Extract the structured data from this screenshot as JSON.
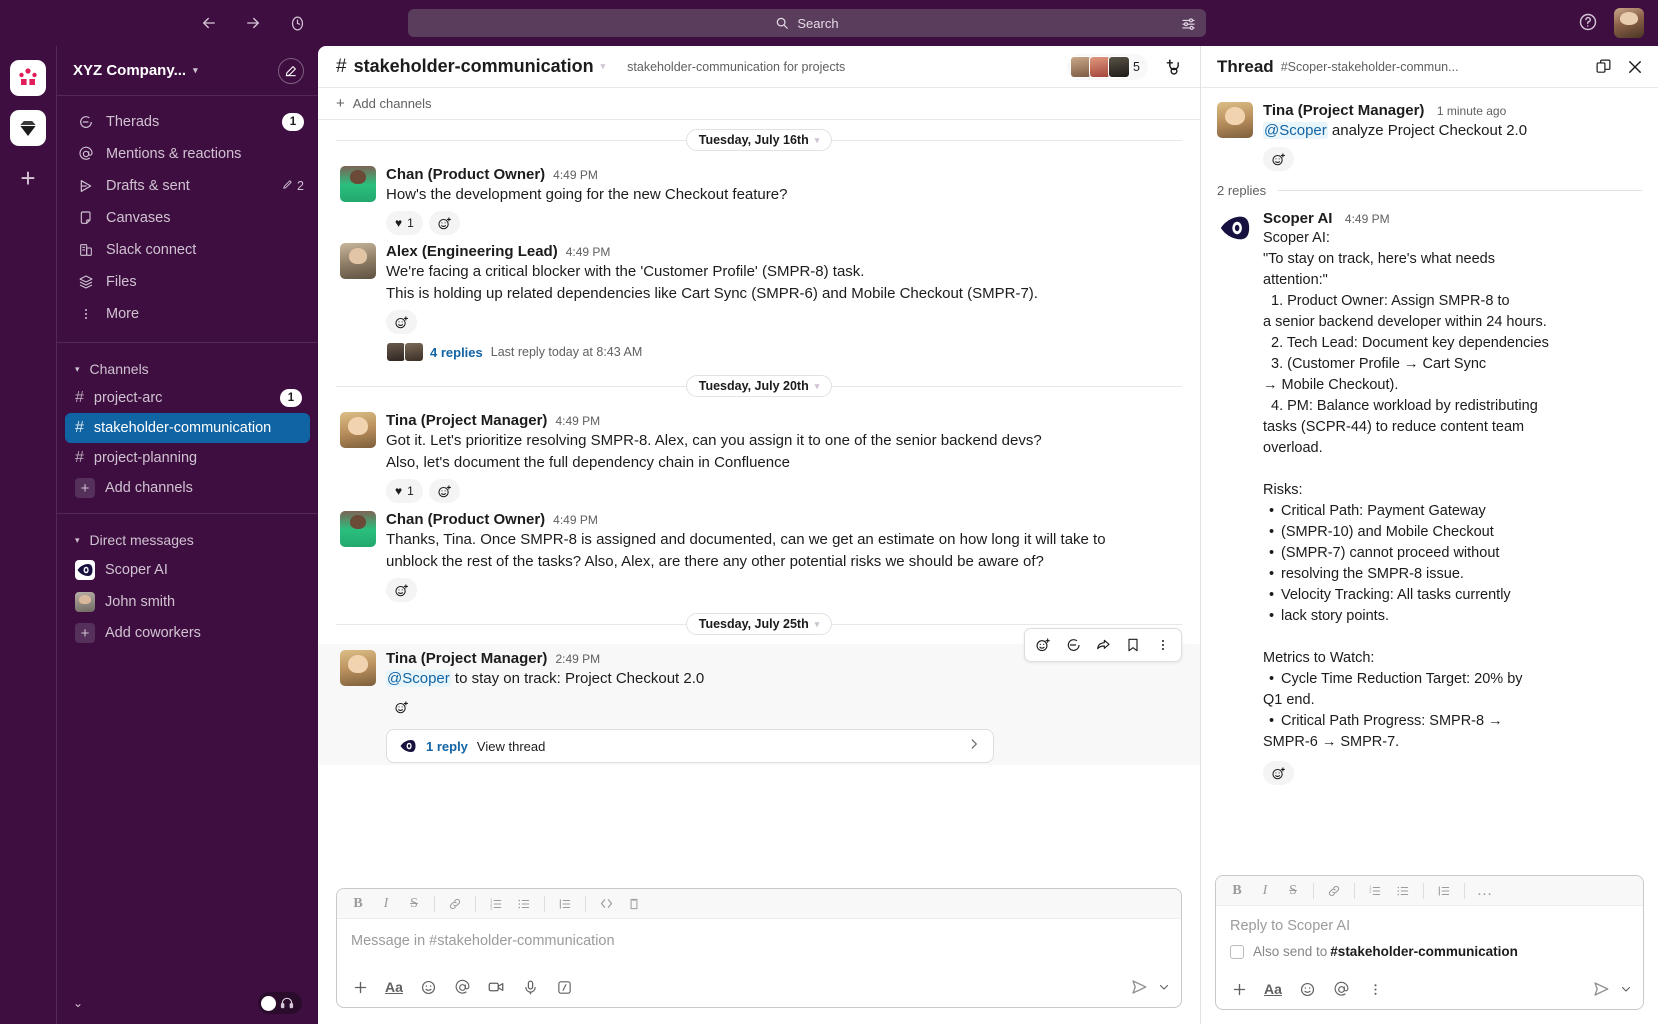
{
  "topbar": {
    "back_icon": "arrow-left-icon",
    "forward_icon": "arrow-right-icon",
    "history_icon": "clock-icon",
    "search_placeholder": "Search",
    "help_icon": "question-circle-icon"
  },
  "sidebar": {
    "workspace_name": "XYZ Company...",
    "compose_icon": "compose-icon",
    "nav": [
      {
        "label": "Therads",
        "icon": "threads-icon",
        "badge": "1"
      },
      {
        "label": "Mentions & reactions",
        "icon": "at-icon",
        "badge": ""
      },
      {
        "label": "Drafts & sent",
        "icon": "send-icon",
        "badge": "2"
      },
      {
        "label": "Canvases",
        "icon": "canvas-icon",
        "badge": ""
      },
      {
        "label": "Slack connect",
        "icon": "slack-connect-icon",
        "badge": ""
      },
      {
        "label": "Files",
        "icon": "files-icon",
        "badge": ""
      },
      {
        "label": "More",
        "icon": "more-vertical-icon",
        "badge": ""
      }
    ],
    "channels_title": "Channels",
    "channels": [
      {
        "name": "project-arc",
        "badge": "1",
        "active": false
      },
      {
        "name": "stakeholder-communication",
        "badge": "",
        "active": true
      },
      {
        "name": "project-planning",
        "badge": "",
        "active": false
      }
    ],
    "add_channels": "Add channels",
    "dm_title": "Direct messages",
    "dms": [
      {
        "name": "Scoper AI"
      },
      {
        "name": "John smith"
      }
    ],
    "add_coworkers": "Add coworkers"
  },
  "channel": {
    "hash": "#",
    "name": "stakeholder-communication",
    "topic": "stakeholder-communication for projects",
    "member_count": "5",
    "add_channels_bar": "Add channels",
    "huddle_icon": "huddle-icon"
  },
  "messages": [
    {
      "type": "divider",
      "label": "Tuesday, July 16th"
    },
    {
      "type": "message",
      "avatar": "av-chan",
      "author": "Chan (Product Owner)",
      "time": "4:49 PM",
      "lines": [
        "How's the development going for the new Checkout feature?"
      ],
      "reaction_emoji": "♥",
      "reaction_count": "1",
      "has_add_reaction": true
    },
    {
      "type": "message",
      "avatar": "av-alex",
      "author": "Alex (Engineering Lead)",
      "time": "4:49 PM",
      "lines": [
        "We're facing a critical blocker with the 'Customer Profile' (SMPR-8) task.",
        "This is holding up related dependencies like Cart Sync (SMPR-6) and Mobile Checkout (SMPR-7)."
      ],
      "reaction_emoji": "",
      "reaction_count": "",
      "has_add_reaction": true,
      "thread": {
        "replies": "4 replies",
        "meta": "Last reply today at 8:43 AM"
      }
    },
    {
      "type": "divider",
      "label": "Tuesday, July 20th"
    },
    {
      "type": "message",
      "avatar": "av-tina",
      "author": "Tina (Project Manager)",
      "time": "4:49 PM",
      "lines": [
        "Got it. Let's prioritize resolving SMPR-8. Alex, can you assign it to one of the senior backend devs?",
        "Also, let's document the full dependency chain in Confluence"
      ],
      "reaction_emoji": "♥",
      "reaction_count": "1",
      "has_add_reaction": true
    },
    {
      "type": "message",
      "avatar": "av-chan",
      "author": "Chan (Product Owner)",
      "time": "4:49 PM",
      "lines": [
        "Thanks, Tina. Once SMPR-8 is assigned and documented, can we get an estimate on how long it will take to",
        "unblock the rest of the tasks? Also, Alex, are there any other potential risks we should be aware of?"
      ],
      "reaction_emoji": "",
      "reaction_count": "",
      "has_add_reaction": true
    },
    {
      "type": "divider",
      "label": "Tuesday, July 25th"
    },
    {
      "type": "message",
      "avatar": "av-tina",
      "author": "Tina (Project Manager)",
      "time": "2:49 PM",
      "mention": "@Scoper",
      "lines": [
        " to stay on track: Project Checkout 2.0"
      ],
      "reaction_emoji": "",
      "reaction_count": "",
      "has_add_reaction": true,
      "hovered": true,
      "view_thread": {
        "replies": "1 reply",
        "label": "View thread"
      }
    }
  ],
  "hover_tools": [
    "emoji-icon",
    "reply-icon",
    "share-icon",
    "bookmark-icon",
    "more-icon"
  ],
  "composer": {
    "placeholder": "Message in #stakeholder-communication",
    "format_buttons": [
      "bold-icon",
      "italic-icon",
      "strikethrough-icon",
      "link-icon",
      "ordered-list-icon",
      "bulleted-list-icon",
      "blockquote-icon",
      "code-icon",
      "code-block-icon"
    ],
    "bottom_buttons": [
      "plus-icon",
      "format-icon",
      "emoji-icon",
      "mention-icon",
      "video-icon",
      "microphone-icon",
      "slash-command-icon"
    ],
    "send_icon": "send-icon",
    "send_caret_icon": "chevron-down-icon"
  },
  "thread": {
    "title": "Thread",
    "subtitle": "#Scoper-stakeholder-commun...",
    "expand_icon": "open-in-new-icon",
    "close_icon": "close-icon",
    "root": {
      "author": "Tina (Project Manager)",
      "time": "1 minute ago",
      "mention": "@Scoper",
      "text": " analyze Project Checkout 2.0"
    },
    "replies_label": "2 replies",
    "reply": {
      "author": "Scoper AI",
      "time": "4:49 PM",
      "lines": [
        {
          "kind": "plain",
          "text": "Scoper AI:"
        },
        {
          "kind": "plain",
          "text": "\"To stay on track, here's what needs"
        },
        {
          "kind": "plain",
          "text": "attention:\""
        },
        {
          "kind": "num",
          "text": "1. Product Owner: Assign SMPR-8 to"
        },
        {
          "kind": "plain",
          "text": "a senior backend developer within 24 hours."
        },
        {
          "kind": "num",
          "text": "2. Tech Lead: Document key dependencies"
        },
        {
          "kind": "num",
          "text": "3. (Customer Profile → Cart Sync"
        },
        {
          "kind": "plain",
          "text": "→ Mobile Checkout)."
        },
        {
          "kind": "num",
          "text": "4. PM: Balance workload by redistributing"
        },
        {
          "kind": "plain",
          "text": "tasks (SCPR-44) to reduce content team"
        },
        {
          "kind": "plain",
          "text": "overload."
        },
        {
          "kind": "gap",
          "text": ""
        },
        {
          "kind": "plain",
          "text": "Risks:"
        },
        {
          "kind": "bullet",
          "text": "Critical Path: Payment Gateway"
        },
        {
          "kind": "bullet",
          "text": "(SMPR-10) and Mobile Checkout"
        },
        {
          "kind": "bullet",
          "text": "(SMPR-7) cannot proceed without"
        },
        {
          "kind": "bullet",
          "text": "resolving the SMPR-8 issue."
        },
        {
          "kind": "bullet",
          "text": "Velocity Tracking: All tasks currently"
        },
        {
          "kind": "bullet",
          "text": "lack story points."
        },
        {
          "kind": "gap",
          "text": ""
        },
        {
          "kind": "plain",
          "text": "Metrics to Watch:"
        },
        {
          "kind": "bullet",
          "text": "Cycle Time Reduction Target: 20% by"
        },
        {
          "kind": "plain",
          "text": "Q1 end."
        },
        {
          "kind": "bullet",
          "text": "Critical Path Progress: SMPR-8 →"
        },
        {
          "kind": "plain",
          "text": "SMPR-6 → SMPR-7."
        }
      ]
    },
    "composer": {
      "placeholder": "Reply to Scoper AI",
      "also_send_prefix": "Also send to ",
      "also_send_channel": "#stakeholder-communication",
      "format_buttons": [
        "bold-icon",
        "italic-icon",
        "strikethrough-icon",
        "link-icon",
        "ordered-list-icon",
        "bulleted-list-icon",
        "blockquote-icon",
        "more-icon"
      ],
      "bottom_buttons": [
        "plus-icon",
        "format-icon",
        "emoji-icon",
        "mention-icon",
        "more-vertical-icon"
      ],
      "send_icon": "send-icon",
      "send_caret_icon": "chevron-down-icon"
    }
  },
  "colors": {
    "sidebar_bg": "#3F0E40",
    "active_channel": "#1164A3",
    "link": "#1264A3"
  }
}
